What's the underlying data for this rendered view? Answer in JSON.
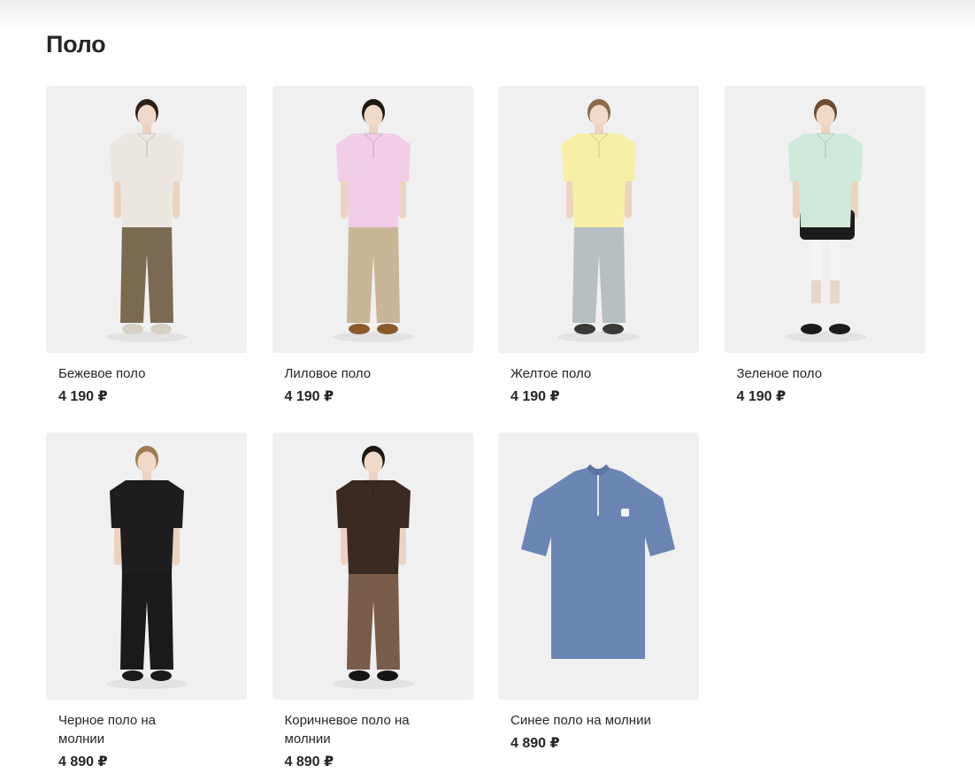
{
  "page": {
    "title": "Поло"
  },
  "products": [
    {
      "name": "Бежевое поло",
      "price": "4 190 ₽",
      "image_icon": "person-beige-polo-icon",
      "shirt_color": "#ece6e1",
      "bottom_color": "#7b6a52",
      "bottom_type": "trousers",
      "shoe_color": "#d6cfc4",
      "sock_color": "#d6cfc4",
      "hair_color": "#2b2119"
    },
    {
      "name": "Лиловое поло",
      "price": "4 190 ₽",
      "image_icon": "person-lilac-polo-icon",
      "shirt_color": "#f2cde6",
      "bottom_color": "#c9b697",
      "bottom_type": "trousers",
      "shoe_color": "#8b5a2b",
      "sock_color": "#8b5a2b",
      "hair_color": "#1e1812"
    },
    {
      "name": "Желтое поло",
      "price": "4 190 ₽",
      "image_icon": "person-yellow-polo-icon",
      "shirt_color": "#f8efa6",
      "bottom_color": "#b8bfc2",
      "bottom_type": "trousers",
      "shoe_color": "#3a3a3a",
      "sock_color": "#3a3a3a",
      "hair_color": "#8a6a4a"
    },
    {
      "name": "Зеленое поло",
      "price": "4 190 ₽",
      "image_icon": "person-green-polo-icon",
      "shirt_color": "#cfe9da",
      "bottom_color": "#1c1c1c",
      "bottom_type": "shorts",
      "shoe_color": "#1c1c1c",
      "sock_color": "#f4f4f4",
      "hair_color": "#6e4a2e"
    },
    {
      "name": "Черное поло на молнии",
      "price": "4 890 ₽",
      "image_icon": "person-black-zip-polo-icon",
      "shirt_color": "#1d1d1f",
      "bottom_color": "#1a1a1c",
      "bottom_type": "trousers",
      "shoe_color": "#1a1a1c",
      "sock_color": "#1a1a1c",
      "hair_color": "#a07a52"
    },
    {
      "name": "Коричневое поло на молнии",
      "price": "4 890 ₽",
      "image_icon": "person-brown-zip-polo-icon",
      "shirt_color": "#3b2a22",
      "bottom_color": "#7a5c4a",
      "bottom_type": "trousers",
      "shoe_color": "#151515",
      "sock_color": "#151515",
      "hair_color": "#1e1812"
    },
    {
      "name": "Синее поло на молнии",
      "price": "4 890 ₽",
      "image_icon": "blue-zip-polo-shirt-icon",
      "shirt_color": "#6b86b5",
      "bottom_type": "flat"
    }
  ]
}
